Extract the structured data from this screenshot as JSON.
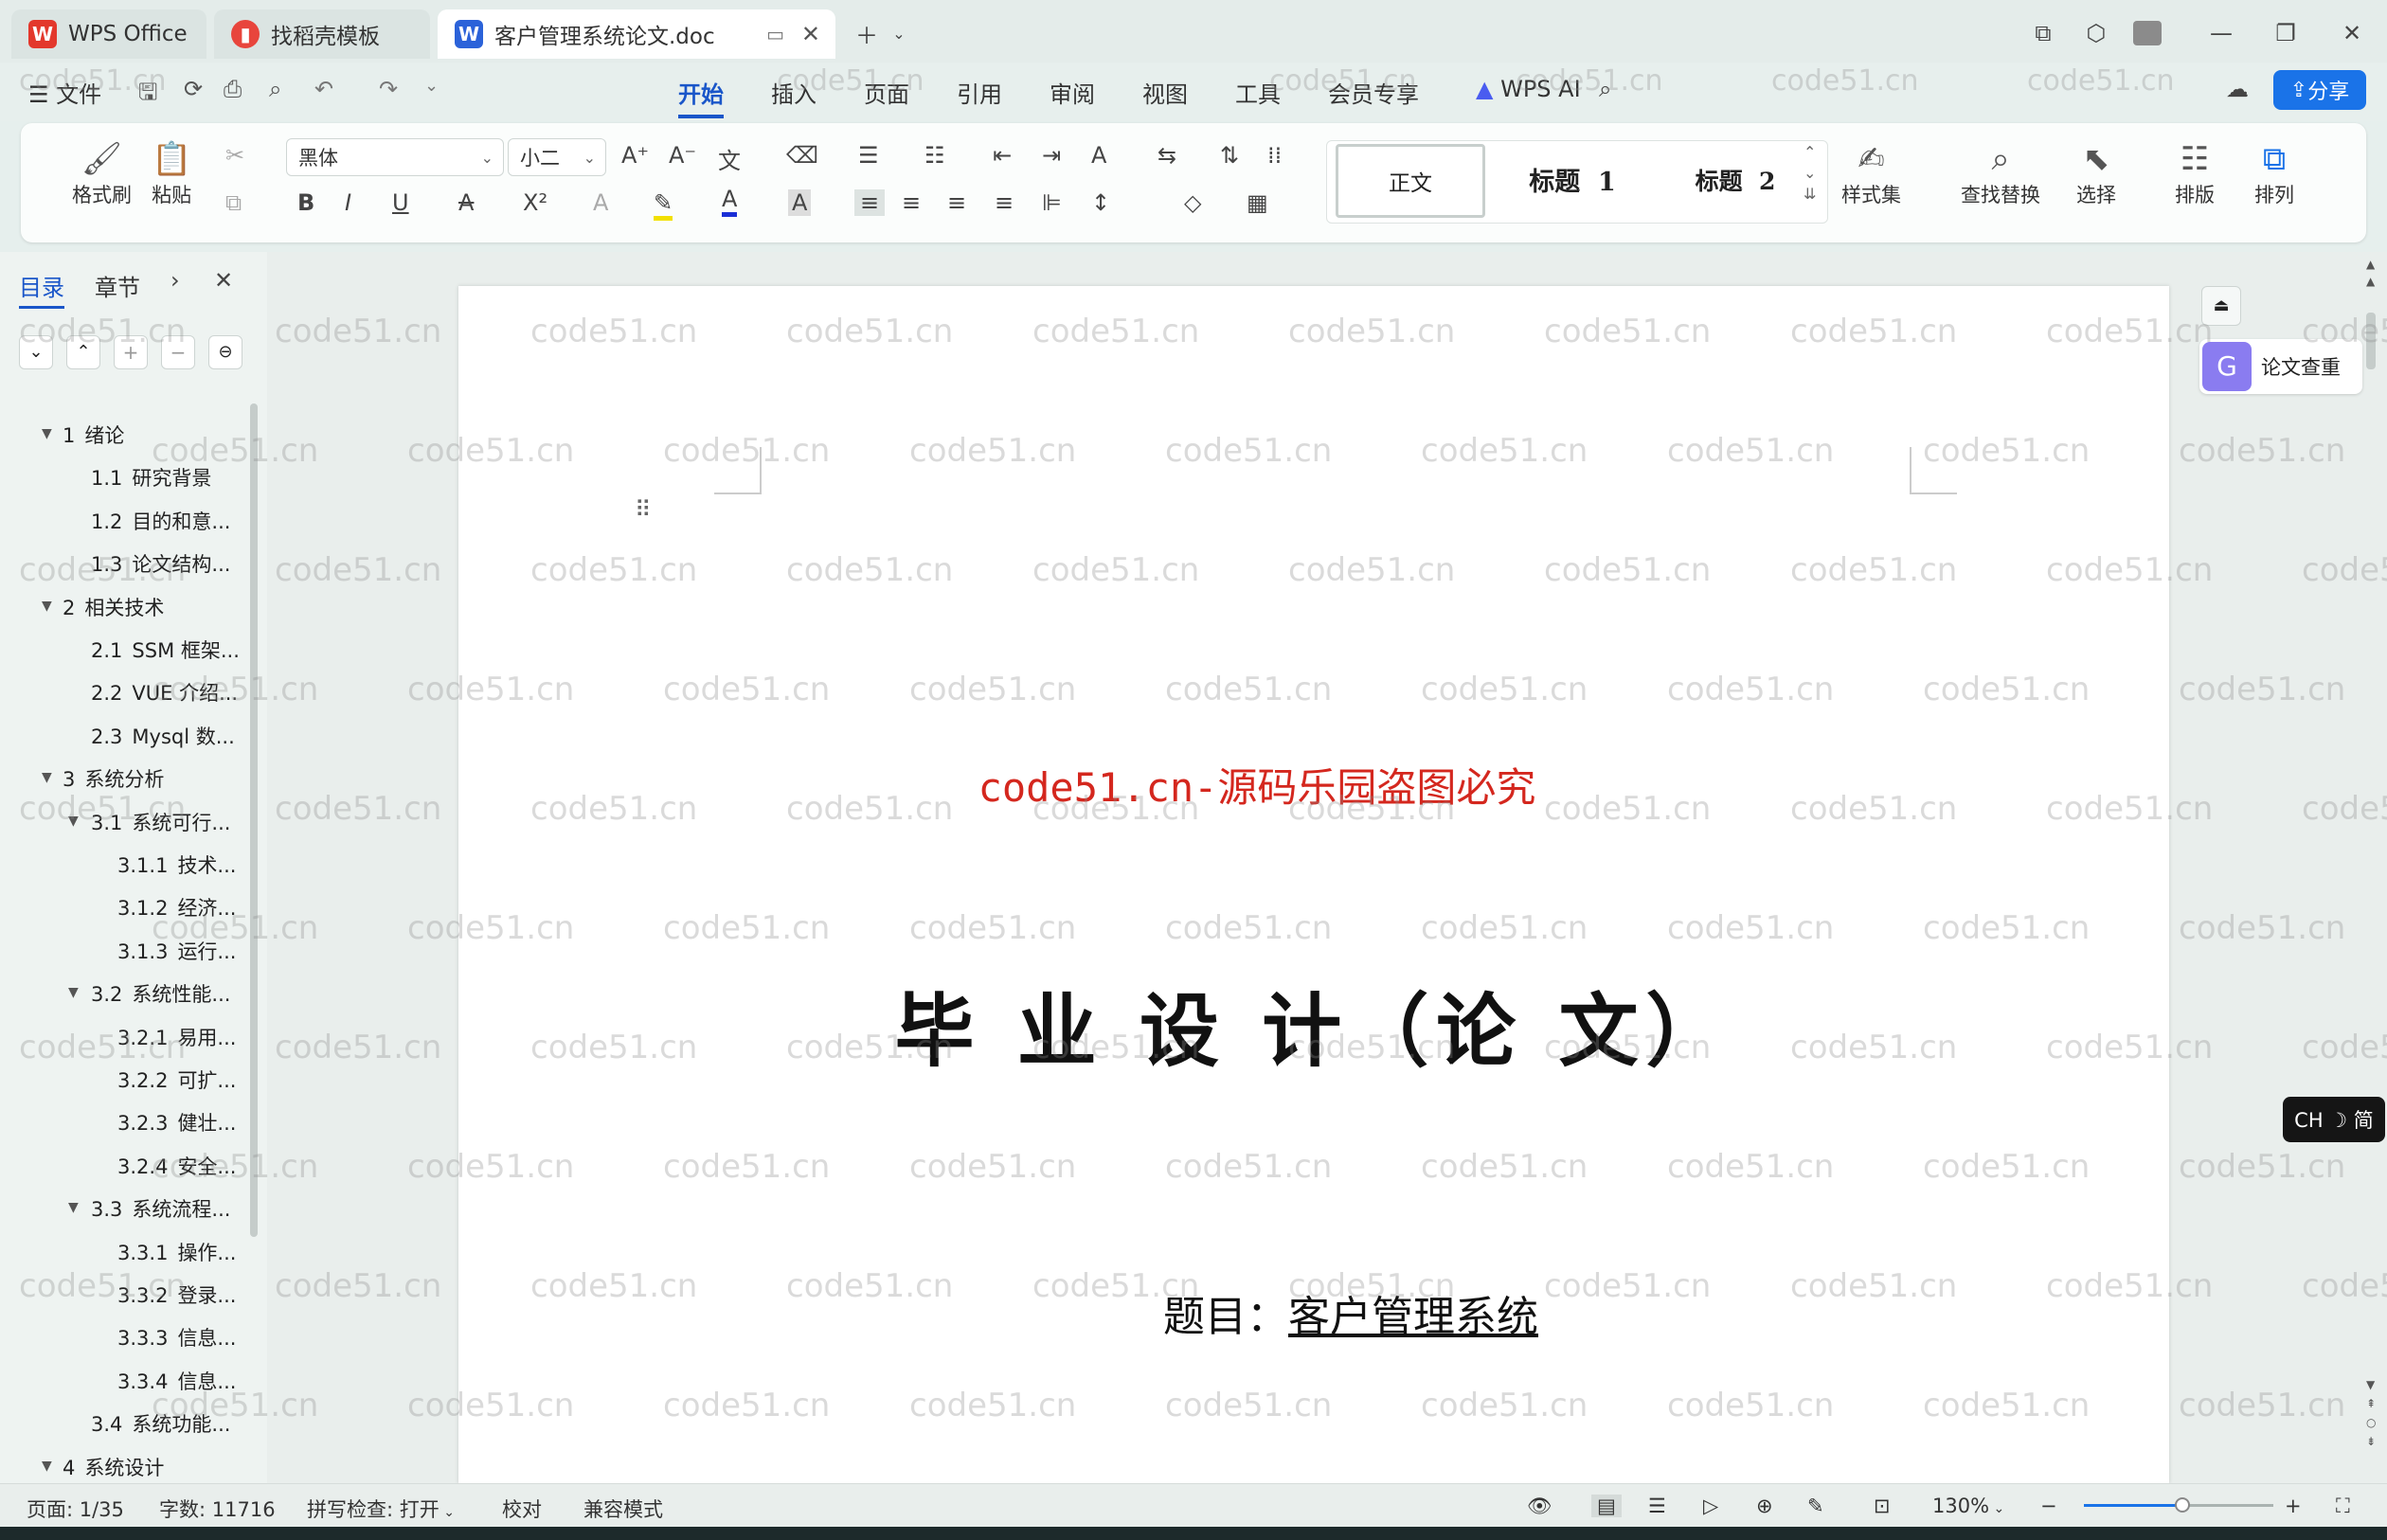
{
  "tabs": [
    {
      "label": "WPS Office"
    },
    {
      "label": "找稻壳模板"
    },
    {
      "label": "客户管理系统论文.doc"
    }
  ],
  "menu": {
    "file": "文件",
    "items": [
      "开始",
      "插入",
      "页面",
      "引用",
      "审阅",
      "视图",
      "工具",
      "会员专享"
    ],
    "wps_ai": "WPS AI",
    "share": "分享"
  },
  "ribbon": {
    "format_painter": "格式刷",
    "paste": "粘贴",
    "font_name": "黑体",
    "font_size": "小二",
    "styles": [
      "正文",
      "标题  1",
      "标题  2"
    ],
    "style_set": "样式集",
    "find_replace": "查找替换",
    "select": "选择",
    "layout": "排版",
    "arrange": "排列"
  },
  "sidebar": {
    "tab_toc": "目录",
    "tab_chapter": "章节",
    "toc": [
      {
        "num": "1",
        "text": "绪论",
        "level": 1
      },
      {
        "num": "1.1",
        "text": "研究背景",
        "level": 2
      },
      {
        "num": "1.2",
        "text": "目的和意...",
        "level": 2
      },
      {
        "num": "1.3",
        "text": "论文结构...",
        "level": 2
      },
      {
        "num": "2",
        "text": "相关技术",
        "level": 1
      },
      {
        "num": "2.1",
        "text": "SSM 框架...",
        "level": 2
      },
      {
        "num": "2.2",
        "text": "VUE 介绍...",
        "level": 2
      },
      {
        "num": "2.3",
        "text": "Mysql 数...",
        "level": 2
      },
      {
        "num": "3",
        "text": "系统分析",
        "level": 1
      },
      {
        "num": "3.1",
        "text": "系统可行...",
        "level": 2
      },
      {
        "num": "3.1.1",
        "text": "技术...",
        "level": 3
      },
      {
        "num": "3.1.2",
        "text": "经济...",
        "level": 3
      },
      {
        "num": "3.1.3",
        "text": "运行...",
        "level": 3
      },
      {
        "num": "3.2",
        "text": "系统性能...",
        "level": 2
      },
      {
        "num": "3.2.1",
        "text": "易用...",
        "level": 3
      },
      {
        "num": "3.2.2",
        "text": "可扩...",
        "level": 3
      },
      {
        "num": "3.2.3",
        "text": "健壮...",
        "level": 3
      },
      {
        "num": "3.2.4",
        "text": "安全...",
        "level": 3
      },
      {
        "num": "3.3",
        "text": "系统流程...",
        "level": 2
      },
      {
        "num": "3.3.1",
        "text": "操作...",
        "level": 3
      },
      {
        "num": "3.3.2",
        "text": "登录...",
        "level": 3
      },
      {
        "num": "3.3.3",
        "text": "信息...",
        "level": 3
      },
      {
        "num": "3.3.4",
        "text": "信息...",
        "level": 3
      },
      {
        "num": "3.4",
        "text": "系统功能...",
        "level": 2
      },
      {
        "num": "4",
        "text": "系统设计",
        "level": 1
      }
    ]
  },
  "document": {
    "red_notice": "code51.cn-源码乐园盗图必究",
    "main_title": "毕 业 设 计（论 文）",
    "subject_label": "题目：",
    "subject_value": "客户管理系统"
  },
  "right_panel": {
    "paper_check": "论文查重",
    "ime": "CH ☽ 简"
  },
  "status": {
    "page": "页面: 1/35",
    "words": "字数: 11716",
    "spell": "拼写检查: 打开",
    "proof": "校对",
    "compat": "兼容模式",
    "zoom": "130%"
  },
  "watermark": "code51.cn",
  "colors": {
    "accent": "#1a73e8",
    "wps_red": "#e3382c",
    "notice_red": "#d4271e"
  }
}
